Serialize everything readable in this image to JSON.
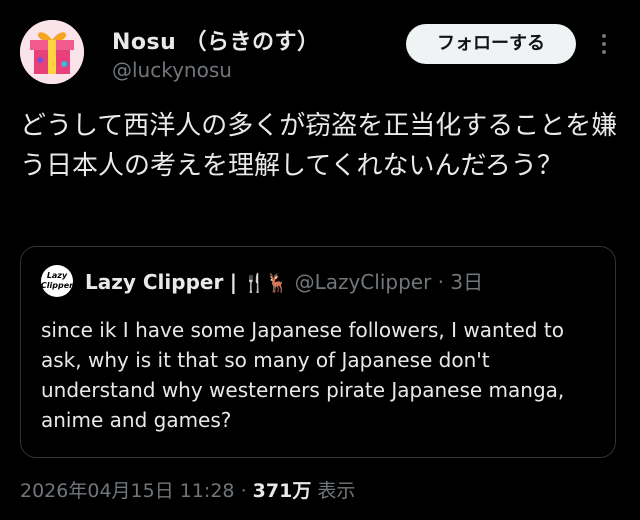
{
  "author": {
    "name": "Nosu （らきのす）",
    "handle": "@luckynosu",
    "avatar_icon": "gift-box-avatar"
  },
  "follow_button": {
    "label": "フォローする"
  },
  "more_menu": {
    "icon": "more-vertical-icon"
  },
  "tweet": {
    "text": "どうして西洋人の多くが窃盗を正当化することを嫌う日本人の考えを理解してくれないんだろう？"
  },
  "quote": {
    "avatar_text": [
      "Lazy",
      "Clipper"
    ],
    "name": "Lazy Clipper",
    "name_suffix": "|",
    "emoji": "🍴🦌",
    "handle": "@LazyClipper",
    "time": "3日",
    "text": "since ik I have some Japanese followers, I wanted to ask, why is it that so many of Japanese don't understand why westerners pirate Japanese manga, anime and games?"
  },
  "meta": {
    "timestamp": "2026年04月15日 11:28",
    "separator": "·",
    "views_count": "371万",
    "views_label": "表示"
  },
  "colors": {
    "background": "#000000",
    "text": "#e7e9ea",
    "secondary": "#71767b",
    "border": "#2f3336",
    "button_bg": "#eff3f4"
  }
}
